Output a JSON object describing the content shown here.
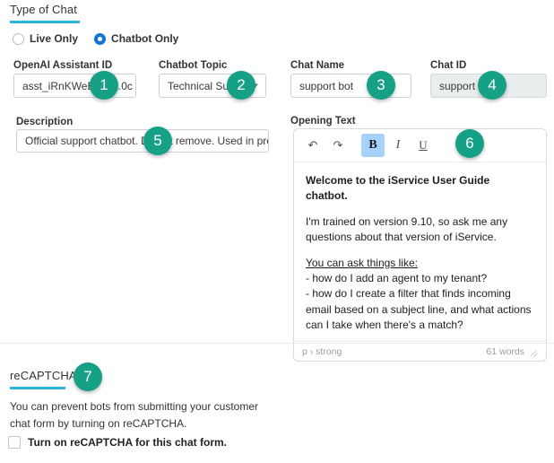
{
  "sections": {
    "type_of_chat": {
      "title": "Type of Chat"
    },
    "recaptcha": {
      "title": "reCAPTCHA",
      "description": "You can prevent bots from submitting your customer chat form by turning on reCAPTCHA.",
      "checkbox_label": "Turn on reCAPTCHA for this chat form.",
      "checked": false
    }
  },
  "chat_type": {
    "options": [
      {
        "label": "Live Only",
        "selected": false
      },
      {
        "label": "Chatbot Only",
        "selected": true
      }
    ]
  },
  "fields": {
    "assistant_id": {
      "label": "OpenAI Assistant ID",
      "value": "asst_iRnKWeBWe…​0c",
      "placeholder": ""
    },
    "chatbot_topic": {
      "label": "Chatbot Topic",
      "value": "Technical Support",
      "options": [
        "Technical Support"
      ]
    },
    "chat_name": {
      "label": "Chat Name",
      "value": "support bot",
      "placeholder": ""
    },
    "chat_id": {
      "label": "Chat ID",
      "value": "support",
      "readonly": true
    },
    "description": {
      "label": "Description",
      "value": "Official support chatbot. Do not remove. Used in production.",
      "placeholder": ""
    },
    "opening_text": {
      "label": "Opening Text"
    }
  },
  "editor": {
    "toolbar": [
      {
        "name": "undo-icon",
        "glyph": "↶",
        "active": false
      },
      {
        "name": "redo-icon",
        "glyph": "↷",
        "active": false
      },
      {
        "name": "bold-icon",
        "glyph": "B",
        "active": true
      },
      {
        "name": "italic-icon",
        "glyph": "I",
        "active": false
      },
      {
        "name": "underline-icon",
        "glyph": "U",
        "active": false
      }
    ],
    "content": {
      "heading": "Welcome to the iService User Guide chatbot.",
      "paragraph": "I'm trained on version 9.10, so ask me any questions about that version of iService.",
      "prompt_intro": "You can ask things like:",
      "examples": [
        "- how do I add an agent to my tenant?",
        "- how do I create a filter that finds incoming email based on a subject line, and what actions can I take when there's a match?"
      ]
    },
    "status": {
      "path": "p › strong",
      "word_count": "61 words"
    }
  },
  "callouts": [
    {
      "number": "1"
    },
    {
      "number": "2"
    },
    {
      "number": "3"
    },
    {
      "number": "4"
    },
    {
      "number": "5"
    },
    {
      "number": "6"
    },
    {
      "number": "7"
    }
  ],
  "colors": {
    "badge": "#16a085",
    "heading_rule": "#29b6d8",
    "radio_selected": "#1273d4",
    "toolbar_active": "#a5d2fb"
  }
}
